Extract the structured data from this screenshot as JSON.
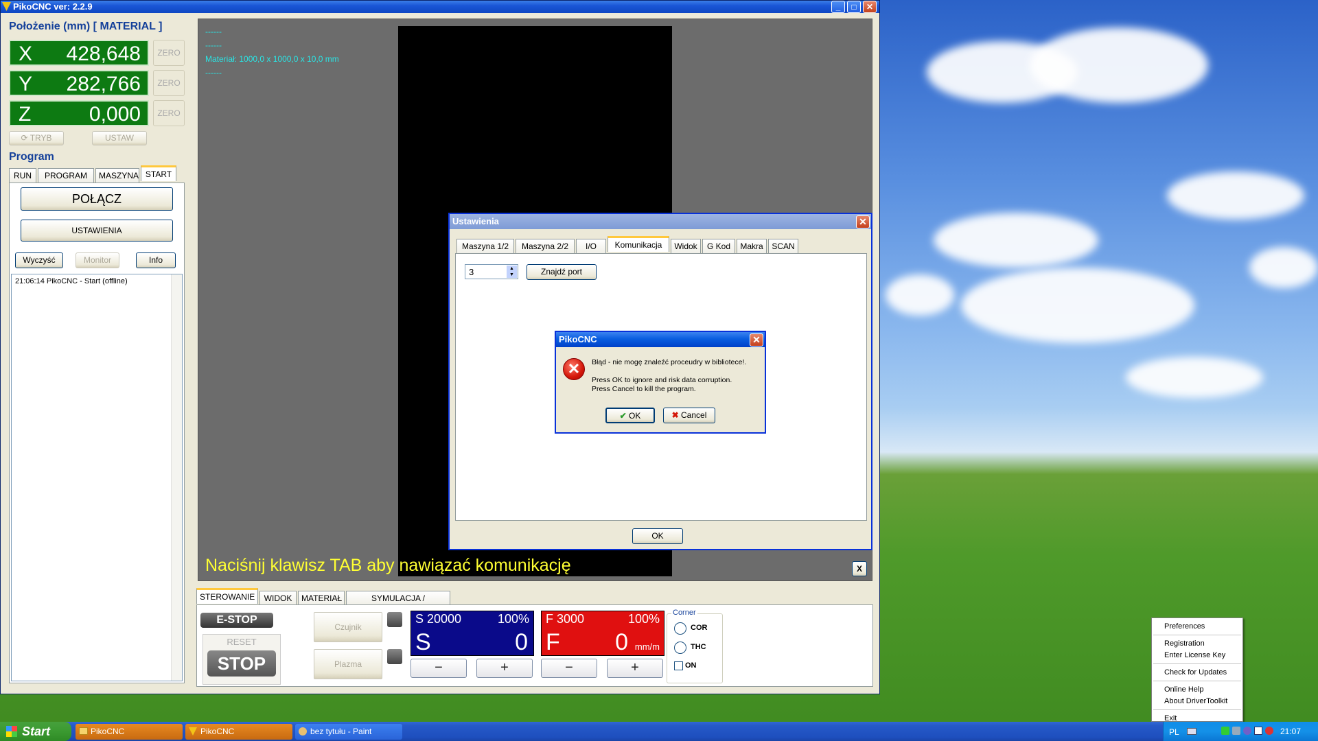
{
  "window": {
    "title": "PikoCNC ver: 2.2.9"
  },
  "position_panel": {
    "title": "Położenie (mm) [ MATERIAL ]",
    "axes": [
      {
        "axis": "X",
        "value": "428,648",
        "zero_label": "ZERO"
      },
      {
        "axis": "Y",
        "value": "282,766",
        "zero_label": "ZERO"
      },
      {
        "axis": "Z",
        "value": "0,000",
        "zero_label": "ZERO"
      }
    ],
    "tryb_label": "TRYB",
    "ustaw_label": "USTAW"
  },
  "program_panel": {
    "title": "Program",
    "tabs": [
      "RUN",
      "PROGRAM",
      "MASZYNA",
      "START"
    ],
    "connect_label": "POŁĄCZ",
    "settings_label": "USTAWIENIA",
    "clear_label": "Wyczyść",
    "monitor_label": "Monitor",
    "info_label": "Info",
    "log": [
      "21:06:14 PikoCNC - Start (offline)"
    ]
  },
  "canvas": {
    "info_lines": [
      "------",
      "------",
      "Materiał: 1000,0 x 1000,0 x 10,0 mm",
      "------"
    ],
    "message": "Naciśnij klawisz TAB aby nawiązać komunikację",
    "close_label": "X"
  },
  "control": {
    "tabs": [
      "STEROWANIE",
      "WIDOK",
      "MATERIAŁ",
      "SYMULACJA / NARZĘDZIA"
    ],
    "estop_label": "E-STOP",
    "reset_label": "RESET",
    "stop_label": "STOP",
    "probe_label": "Czujnik",
    "plasma_label": "Plazma",
    "spindle": {
      "setting": "S 20000",
      "percent": "100%",
      "letter": "S",
      "value": "0",
      "color": "#0a0a8a"
    },
    "feed": {
      "setting": "F 3000",
      "percent": "100%",
      "letter": "F",
      "value": "0",
      "unit": "mm/m",
      "color": "#e01010"
    },
    "minus": "−",
    "plus": "+",
    "corner_title": "Corner",
    "cor_label": "COR",
    "thc_label": "THC",
    "on_label": "ON"
  },
  "settings_dialog": {
    "title": "Ustawienia",
    "tabs": [
      "Maszyna 1/2",
      "Maszyna 2/2",
      "I/O",
      "Komunikacja",
      "Widok",
      "G Kod",
      "Makra",
      "SCAN"
    ],
    "port_value": "3",
    "find_port_label": "Znajdź port",
    "ok_label": "OK"
  },
  "error_dialog": {
    "title": "PikoCNC",
    "line1": "Błąd - nie mogę znaleźć proceudry w bibliotece!.",
    "line2": "Press OK to ignore and risk data corruption.",
    "line3": "Press Cancel to kill the program.",
    "ok_label": "OK",
    "cancel_label": "Cancel"
  },
  "context_menu": {
    "items": [
      "Preferences",
      "Registration",
      "Enter License Key",
      "Check for Updates",
      "Online Help",
      "About DriverToolkit",
      "Exit"
    ]
  },
  "taskbar": {
    "start_label": "Start",
    "items": [
      "PikoCNC",
      "PikoCNC",
      "bez tytułu - Paint"
    ],
    "lang": "PL",
    "clock": "21:07"
  }
}
